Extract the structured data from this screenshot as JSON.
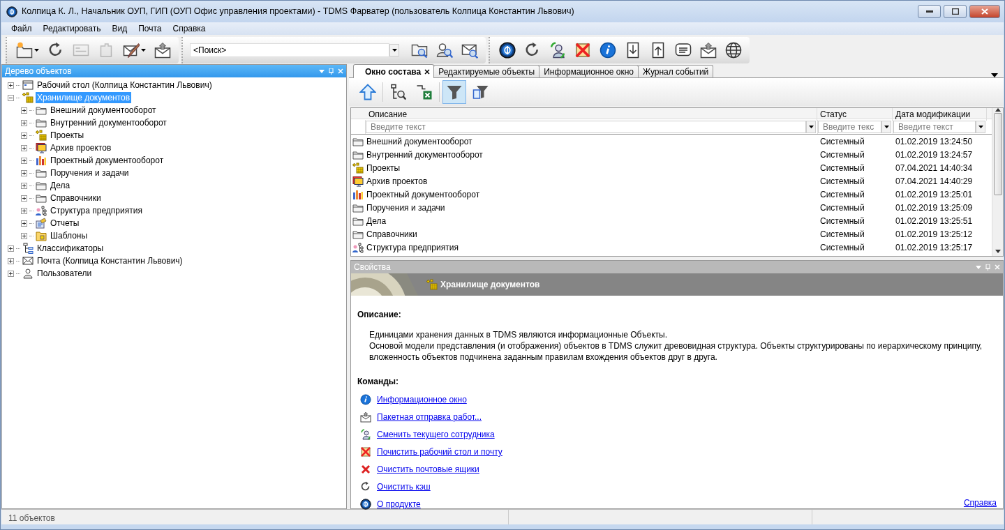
{
  "window": {
    "title": "Колпица К. Л., Начальник ОУП, ГИП (ОУП Офис управления проектами) - TDMS Фарватер (пользователь Колпица Константин Львович)"
  },
  "menu": [
    "Файл",
    "Редактировать",
    "Вид",
    "Почта",
    "Справка"
  ],
  "toolbar": {
    "groups": [
      [
        {
          "kind": "new-folder",
          "disabled": false,
          "dropdown": true
        },
        {
          "kind": "refresh",
          "disabled": false,
          "dropdown": false
        },
        {
          "kind": "card",
          "disabled": true,
          "dropdown": false
        },
        {
          "kind": "puzzle",
          "disabled": true,
          "dropdown": false
        },
        {
          "kind": "mail-edit",
          "disabled": false,
          "dropdown": true
        },
        {
          "kind": "mail-send",
          "disabled": false,
          "dropdown": false
        }
      ],
      [
        {
          "kind": "folder-search",
          "disabled": false,
          "dropdown": false
        },
        {
          "kind": "user-search",
          "disabled": false,
          "dropdown": false
        },
        {
          "kind": "mail-search",
          "disabled": false,
          "dropdown": false
        }
      ],
      [
        {
          "kind": "logo",
          "disabled": false,
          "dropdown": false
        },
        {
          "kind": "refresh",
          "disabled": false,
          "dropdown": false
        },
        {
          "kind": "users-swap",
          "disabled": false,
          "dropdown": false
        },
        {
          "kind": "clean",
          "disabled": false,
          "dropdown": false
        },
        {
          "kind": "info",
          "disabled": false,
          "dropdown": false
        },
        {
          "kind": "doc-down",
          "disabled": false,
          "dropdown": false
        },
        {
          "kind": "doc-up",
          "disabled": false,
          "dropdown": false
        },
        {
          "kind": "message",
          "disabled": false,
          "dropdown": false
        },
        {
          "kind": "mail-up",
          "disabled": false,
          "dropdown": false
        },
        {
          "kind": "globe",
          "disabled": false,
          "dropdown": false
        }
      ]
    ],
    "search": {
      "value": "<Поиск>"
    }
  },
  "tree_panel": {
    "title": "Дерево объектов",
    "items": [
      {
        "label": "Рабочий стол (Колпица Константин Львович)",
        "kind": "desktop",
        "expanded": false,
        "selected": false
      },
      {
        "label": "Хранилище документов",
        "kind": "storage",
        "expanded": true,
        "selected": true,
        "children": [
          {
            "label": "Внешний документооборот",
            "kind": "folder",
            "expanded": false,
            "selected": false
          },
          {
            "label": "Внутренний документооборот",
            "kind": "folder",
            "expanded": false,
            "selected": false
          },
          {
            "label": "Проекты",
            "kind": "storage",
            "expanded": false,
            "selected": false
          },
          {
            "label": "Архив проектов",
            "kind": "archive",
            "expanded": false,
            "selected": false
          },
          {
            "label": "Проектный документооборот",
            "kind": "chart",
            "expanded": false,
            "selected": false
          },
          {
            "label": "Поручения и задачи",
            "kind": "folder",
            "expanded": false,
            "selected": false
          },
          {
            "label": "Дела",
            "kind": "folder",
            "expanded": false,
            "selected": false
          },
          {
            "label": "Справочники",
            "kind": "folder",
            "expanded": false,
            "selected": false
          },
          {
            "label": "Структура предприятия",
            "kind": "org",
            "expanded": false,
            "selected": false
          },
          {
            "label": "Отчеты",
            "kind": "report",
            "expanded": false,
            "selected": false
          },
          {
            "label": "Шаблоны",
            "kind": "templates",
            "expanded": false,
            "selected": false
          }
        ]
      },
      {
        "label": "Классификаторы",
        "kind": "classifier",
        "expanded": false,
        "selected": false
      },
      {
        "label": "Почта (Колпица Константин Львович)",
        "kind": "mail",
        "expanded": false,
        "selected": false
      },
      {
        "label": "Пользователи",
        "kind": "users",
        "expanded": false,
        "selected": false
      }
    ]
  },
  "tabs": [
    {
      "label": "Окно состава",
      "selected": true
    },
    {
      "label": "Редактируемые объекты",
      "selected": false
    },
    {
      "label": "Информационное окно",
      "selected": false
    },
    {
      "label": "Журнал событий",
      "selected": false
    }
  ],
  "view_toolbar": [
    {
      "kind": "up",
      "selected": false
    },
    {
      "kind": "tree-search",
      "selected": false
    },
    {
      "kind": "excel",
      "selected": false
    },
    {
      "kind": "filter",
      "selected": true
    },
    {
      "kind": "filter-table",
      "selected": false
    }
  ],
  "table": {
    "columns": [
      {
        "label": "Описание",
        "placeholder": "Введите текст"
      },
      {
        "label": "Статус",
        "placeholder": "Введите текс"
      },
      {
        "label": "Дата модификации",
        "placeholder": "Введите текст"
      }
    ],
    "rows": [
      {
        "kind": "folder",
        "cells": [
          "Внешний документооборот",
          "Системный",
          "01.02.2019 13:24:50"
        ]
      },
      {
        "kind": "folder",
        "cells": [
          "Внутренний документооборот",
          "Системный",
          "01.02.2019 13:24:57"
        ]
      },
      {
        "kind": "storage",
        "cells": [
          "Проекты",
          "Системный",
          "07.04.2021 14:40:34"
        ]
      },
      {
        "kind": "archive",
        "cells": [
          "Архив проектов",
          "Системный",
          "07.04.2021 14:40:29"
        ]
      },
      {
        "kind": "chart",
        "cells": [
          "Проектный документооборот",
          "Системный",
          "01.02.2019 13:25:01"
        ]
      },
      {
        "kind": "folder",
        "cells": [
          "Поручения и задачи",
          "Системный",
          "01.02.2019 13:25:09"
        ]
      },
      {
        "kind": "folder",
        "cells": [
          "Дела",
          "Системный",
          "01.02.2019 13:25:51"
        ]
      },
      {
        "kind": "folder",
        "cells": [
          "Справочники",
          "Системный",
          "01.02.2019 13:25:12"
        ]
      },
      {
        "kind": "org",
        "cells": [
          "Структура предприятия",
          "Системный",
          "01.02.2019 13:25:17"
        ]
      }
    ]
  },
  "properties": {
    "title": "Свойства",
    "header": {
      "label": "Хранилище документов",
      "kind": "storage"
    },
    "description_heading": "Описание:",
    "description": [
      "Единицами хранения данных в TDMS являются информационные Объекты.",
      "Основой модели представления (и отображения) объектов в TDMS служит древовидная структура. Объекты структурированы по иерархическому принципу, вложенность объектов подчинена заданным правилам вхождения объектов друг в друга."
    ],
    "commands_heading": "Команды:",
    "commands": [
      {
        "label": "Информационное окно",
        "kind": "info"
      },
      {
        "label": "Пакетная отправка работ...",
        "kind": "mail-send"
      },
      {
        "label": "Сменить текущего сотрудника",
        "kind": "users-swap"
      },
      {
        "label": "Почистить рабочий стол и почту",
        "kind": "clean"
      },
      {
        "label": "Очистить почтовые ящики",
        "kind": "delete"
      },
      {
        "label": "Очистить кэш",
        "kind": "refresh"
      },
      {
        "label": "О продукте",
        "kind": "logo"
      }
    ],
    "help_link": "Справка"
  },
  "status_bar": {
    "text": "11 объектов"
  }
}
